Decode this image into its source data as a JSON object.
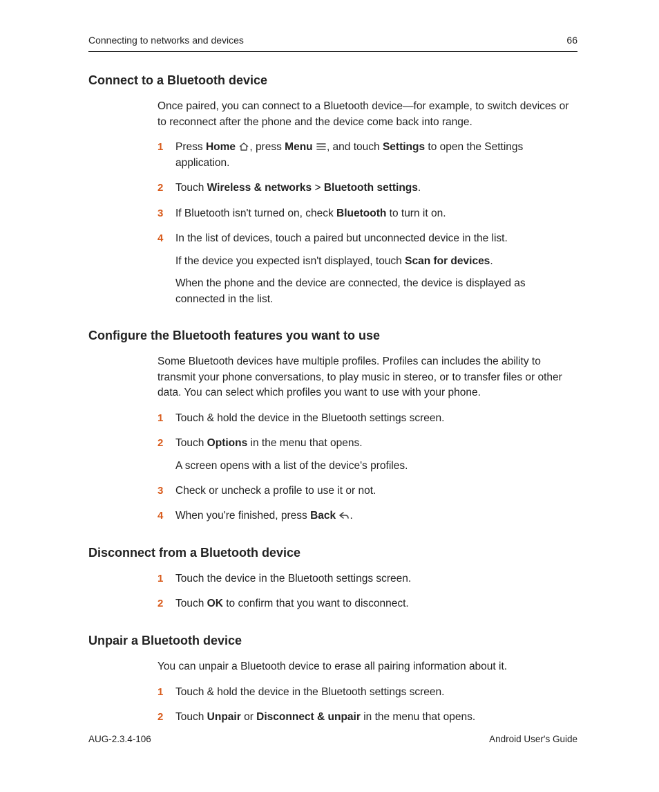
{
  "header": {
    "chapter": "Connecting to networks and devices",
    "page_number": "66"
  },
  "footer": {
    "doc_id": "AUG-2.3.4-106",
    "guide_name": "Android User's Guide"
  },
  "sections": {
    "connect": {
      "title": "Connect to a Bluetooth device",
      "intro": "Once paired, you can connect to a Bluetooth device—for example, to switch devices or to reconnect after the phone and the device come back into range.",
      "steps": [
        {
          "num": "1",
          "t1a": "Press ",
          "t1b": "Home",
          "t2a": ", press ",
          "t2b": "Menu",
          "t3a": ", and touch ",
          "t3b": "Settings",
          "t4": " to open the Settings application."
        },
        {
          "num": "2",
          "a": "Touch ",
          "b1": "Wireless & networks",
          "mid": " > ",
          "b2": "Bluetooth settings",
          "end": "."
        },
        {
          "num": "3",
          "a": "If Bluetooth isn't turned on, check ",
          "b": "Bluetooth",
          "end": " to turn it on."
        },
        {
          "num": "4",
          "line1": "In the list of devices, touch a paired but unconnected device in the list.",
          "line2a": "If the device you expected isn't displayed, touch ",
          "line2b": "Scan for devices",
          "line2c": ".",
          "line3": "When the phone and the device are connected, the device is displayed as connected in the list."
        }
      ]
    },
    "configure": {
      "title": "Configure the Bluetooth features you want to use",
      "intro": "Some Bluetooth devices have multiple profiles. Profiles can includes the ability to transmit your phone conversations, to play music in stereo, or to transfer files or other data. You can select which profiles you want to use with your phone.",
      "steps": [
        {
          "num": "1",
          "text": "Touch & hold the device in the Bluetooth settings screen."
        },
        {
          "num": "2",
          "a": "Touch ",
          "b": "Options",
          "end": " in the menu that opens.",
          "sub": "A screen opens with a list of the device's profiles."
        },
        {
          "num": "3",
          "text": "Check or uncheck a profile to use it or not."
        },
        {
          "num": "4",
          "a": "When you're finished, press ",
          "b": "Back",
          "end": "."
        }
      ]
    },
    "disconnect": {
      "title": "Disconnect from a Bluetooth device",
      "steps": [
        {
          "num": "1",
          "text": "Touch the device in the Bluetooth settings screen."
        },
        {
          "num": "2",
          "a": "Touch ",
          "b": "OK",
          "end": " to confirm that you want to disconnect."
        }
      ]
    },
    "unpair": {
      "title": "Unpair a Bluetooth device",
      "intro": "You can unpair a Bluetooth device to erase all pairing information about it.",
      "steps": [
        {
          "num": "1",
          "text": "Touch & hold the device in the Bluetooth settings screen."
        },
        {
          "num": "2",
          "a": "Touch ",
          "b1": "Unpair",
          "mid": " or ",
          "b2": "Disconnect & unpair",
          "end": " in the menu that opens."
        }
      ]
    }
  }
}
